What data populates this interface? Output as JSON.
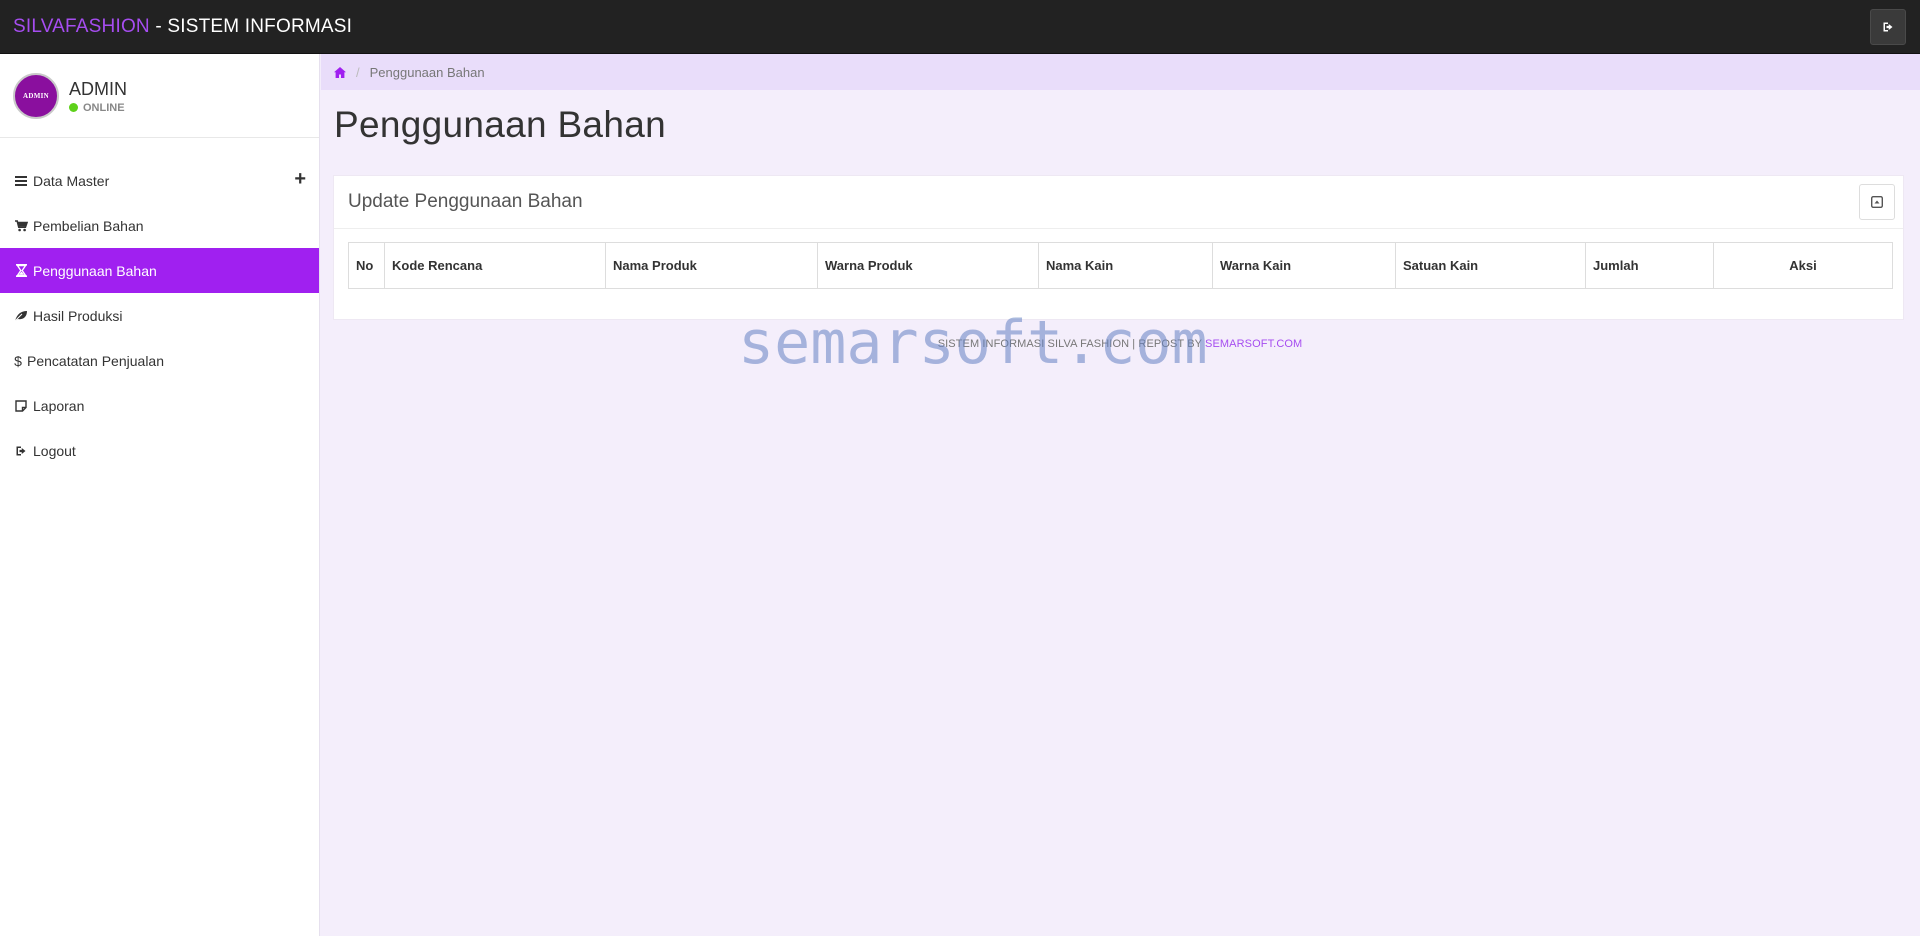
{
  "header": {
    "brand_accent": "SILVAFASHION",
    "brand_rest": " - SISTEM INFORMASI",
    "logout_icon": "sign-out-icon"
  },
  "user": {
    "avatar_text": "ADMIN",
    "name": "ADMIN",
    "status": "ONLINE"
  },
  "sidebar": {
    "items": [
      {
        "label": "Data Master",
        "icon": "bars-icon"
      },
      {
        "label": "Pembelian Bahan",
        "icon": "cart-icon"
      },
      {
        "label": "Penggunaan Bahan",
        "icon": "hourglass-icon"
      },
      {
        "label": "Hasil Produksi",
        "icon": "leaf-icon"
      },
      {
        "label": "Pencatatan Penjualan",
        "icon": "dollar-icon"
      },
      {
        "label": "Laporan",
        "icon": "note-icon"
      },
      {
        "label": "Logout",
        "icon": "sign-out-icon"
      }
    ],
    "expand_symbol": "+"
  },
  "breadcrumb": {
    "current": "Penggunaan Bahan"
  },
  "page": {
    "title": "Penggunaan Bahan"
  },
  "card": {
    "title": "Update Penggunaan Bahan"
  },
  "table": {
    "columns": [
      "No",
      "Kode Rencana",
      "Nama Produk",
      "Warna Produk",
      "Nama Kain",
      "Warna Kain",
      "Satuan Kain",
      "Jumlah",
      "Aksi"
    ]
  },
  "footer": {
    "text": "SISTEM INFORMASI SILVA FASHION | REPOST BY ",
    "link": "SEMARSOFT.COM"
  },
  "watermark": "semarsoft.com",
  "colors": {
    "accent": "#a020f0",
    "topbar": "#222222",
    "background": "#f4eefb",
    "breadcrumb_bg": "#e9ddfa"
  }
}
